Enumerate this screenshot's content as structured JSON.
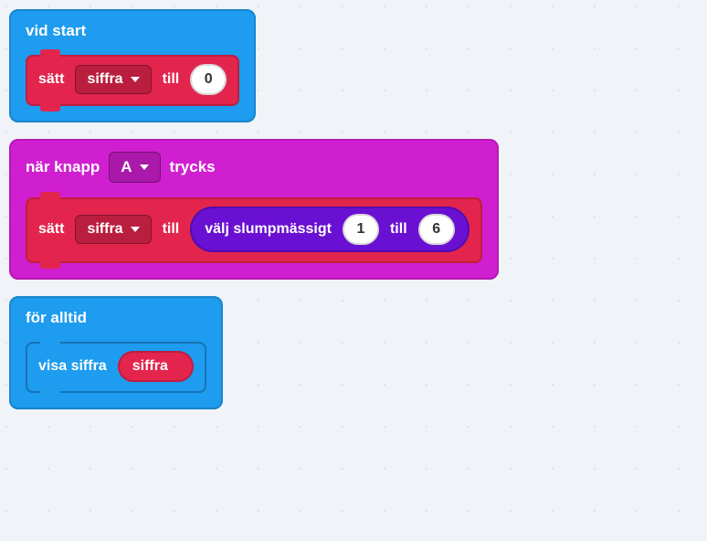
{
  "on_start": {
    "title": "vid start",
    "set_label": "sätt",
    "var_name": "siffra",
    "to_label": "till",
    "value": "0"
  },
  "on_button": {
    "prefix": "när knapp",
    "button": "A",
    "suffix": "trycks",
    "set_label": "sätt",
    "var_name": "siffra",
    "to_label": "till",
    "rand_label": "välj slumpmässigt",
    "rand_from": "1",
    "rand_to_label": "till",
    "rand_to": "6"
  },
  "forever": {
    "title": "för alltid",
    "show_label": "visa siffra",
    "var_name": "siffra"
  }
}
